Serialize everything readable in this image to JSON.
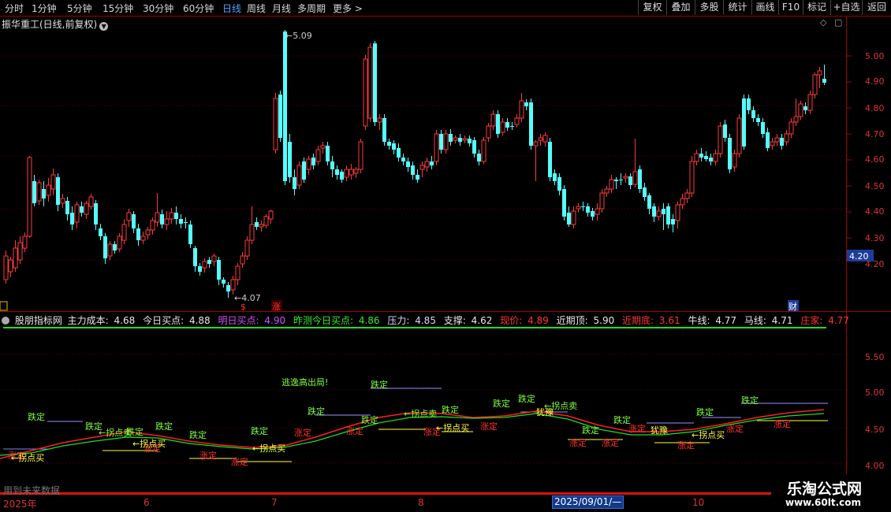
{
  "toolbar": {
    "periods": [
      "分时",
      "1分钟",
      "5分钟",
      "15分钟",
      "30分钟",
      "60分钟",
      "日线",
      "周线",
      "月线",
      "多周期",
      "更多 >"
    ],
    "active_period": "日线",
    "right_buttons": [
      "复权",
      "叠加",
      "多股",
      "统计",
      "画线",
      "F10",
      "标记",
      "+自选",
      "返回"
    ]
  },
  "stock": {
    "title": "振华重工(日线,前复权)",
    "current_price_label": "4.20",
    "high_marker": "5.09",
    "low_marker": "4.07",
    "event_markers": [
      "$",
      "涨",
      "财"
    ]
  },
  "price_axis": {
    "labels": [
      "5.00",
      "4.90",
      "4.80",
      "4.70",
      "4.60",
      "4.50",
      "4.40",
      "4.30",
      "4.20"
    ]
  },
  "indicator": {
    "name": "股朋指标网",
    "items": [
      {
        "label": "主力成本:",
        "value": "4.68",
        "color": "#e8e8e8"
      },
      {
        "label": "今日买点:",
        "value": "4.88",
        "color": "#e8e8e8"
      },
      {
        "label": "明日买点:",
        "value": "4.90",
        "color": "#d050ff"
      },
      {
        "label": "昨测今日买点:",
        "value": "4.86",
        "color": "#33ee33"
      },
      {
        "label": "压力:",
        "value": "4.85",
        "color": "#d8d8ff"
      },
      {
        "label": "支撑:",
        "value": "4.62",
        "color": "#e8e8e8"
      },
      {
        "label": "现价:",
        "value": "4.89",
        "color": "#ff3333"
      },
      {
        "label": "近期顶:",
        "value": "5.90",
        "color": "#e8e8e8"
      },
      {
        "label": "近期底:",
        "value": "3.61",
        "color": "#ff3333"
      },
      {
        "label": "牛线:",
        "value": "4.77",
        "color": "#e8e8e8"
      },
      {
        "label": "马线:",
        "value": "4.71",
        "color": "#e8e8e8"
      },
      {
        "label": "庄家:",
        "value": "4.77",
        "color": "#ff3333"
      }
    ],
    "axis_labels": [
      "5.50",
      "5.00",
      "4.50",
      "4.00"
    ],
    "annotations": {
      "fall_stop": "跌定",
      "rise_stop": "涨定",
      "buy_signal": "←拐点买",
      "sell_signal": "←拐点卖",
      "escape": "逃逸高出局!",
      "hesitate": "犹豫"
    }
  },
  "footer": {
    "future_data_note": "用到未来数据",
    "dates": [
      "2025年",
      "6",
      "7",
      "8",
      "10"
    ],
    "selected_date": "2025/09/01/—"
  },
  "watermark": {
    "name": "乐淘公式网",
    "url": "www.60lt.com"
  },
  "colors": {
    "up": "#ff3a3a",
    "down": "#54ffff",
    "fall_stop": "#7dff3a",
    "rise_stop": "#ff3030",
    "buy": "#ffff40",
    "ma_red": "#ff2020",
    "ma_green": "#20e020"
  }
}
